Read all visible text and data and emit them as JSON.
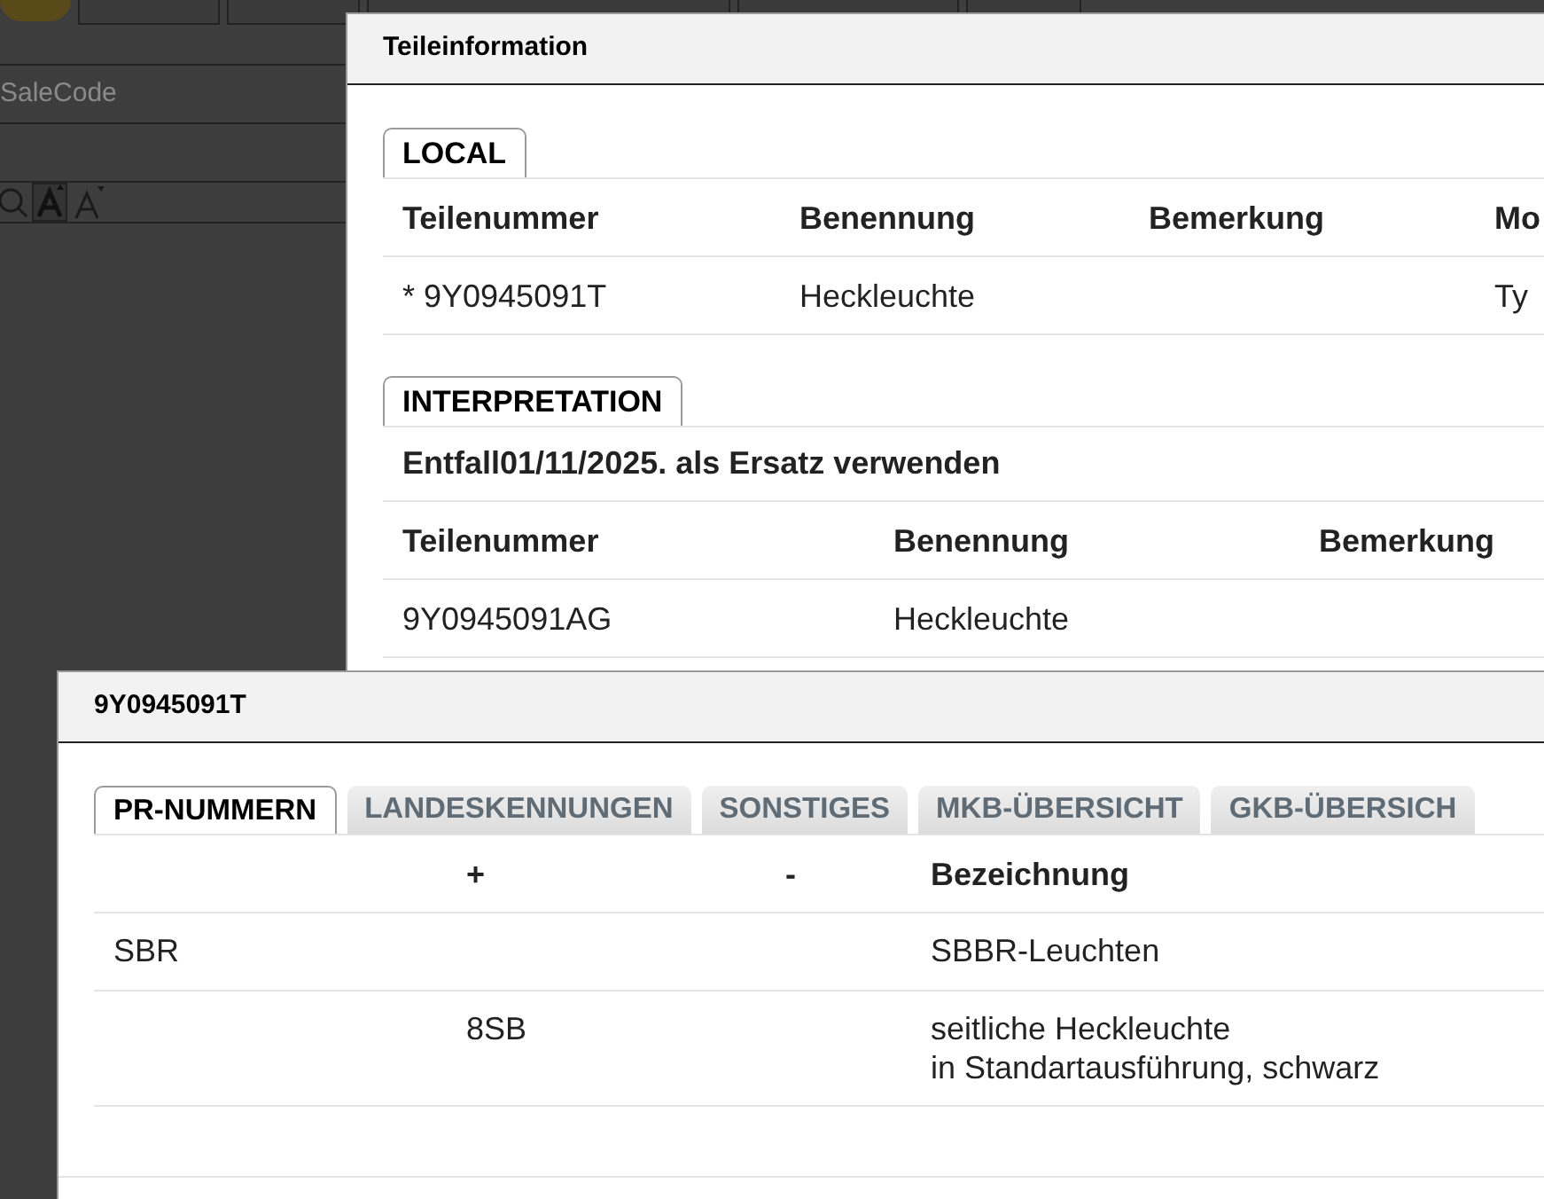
{
  "background": {
    "field": {
      "placeholder": "SaleCode"
    }
  },
  "parts_dialog": {
    "title": "Teileinformation",
    "local": {
      "tab": "LOCAL",
      "columns": [
        "Teilenummer",
        "Benennung",
        "Bemerkung",
        "Mo"
      ],
      "rows": [
        {
          "teilenummer": "* 9Y0945091T",
          "benennung": "Heckleuchte",
          "column_4": "Ty"
        }
      ]
    },
    "interpretation": {
      "tab": "INTERPRETATION",
      "note": "Entfall01/11/2025. als Ersatz verwenden",
      "columns": [
        "Teilenummer",
        "Benennung",
        "Bemerkung"
      ],
      "rows": [
        {
          "teilenummer": "9Y0945091AG",
          "benennung": "Heckleuchte"
        }
      ]
    }
  },
  "detail_dialog": {
    "title": "9Y0945091T",
    "tabs": [
      {
        "label": "PR-NUMMERN",
        "selected": true
      },
      {
        "label": "LANDESKENNUNGEN",
        "selected": false
      },
      {
        "label": "SONSTIGES",
        "selected": false
      },
      {
        "label": "MKB-ÜBERSICHT",
        "selected": false
      },
      {
        "label": "GKB-ÜBERSICH",
        "selected": false
      }
    ],
    "columns": {
      "plus": "+",
      "minus": "-",
      "bezeichnung": "Bezeichnung"
    },
    "rows": [
      {
        "column_1": "SBR",
        "bezeichnung": "SBBR-Leuchten"
      },
      {
        "plus": "8SB",
        "bezeichnung": "seitliche Heckleuchte\nin Standartausführung, schwarz"
      }
    ]
  }
}
